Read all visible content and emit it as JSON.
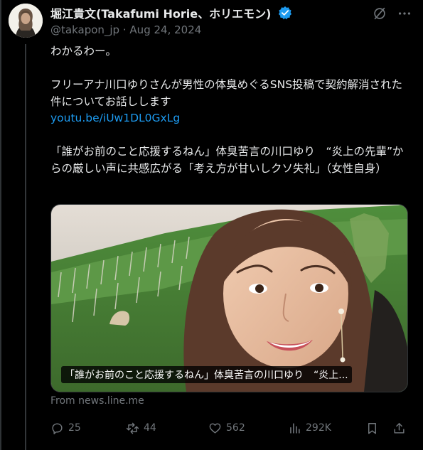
{
  "author": {
    "name": "堀江貴文(Takafumi Horie、ホリエモン)",
    "handle": "@takapon_jp",
    "date": "Aug 24, 2024"
  },
  "tweet": {
    "line1": "わかるわー。",
    "line2": "フリーアナ川口ゆりさんが男性の体臭めぐるSNS投稿で契約解消された件についてお話しします",
    "link": "youtu.be/iUw1DL0GxLg",
    "line3": "「誰がお前のこと応援するねん」体臭苦言の川口ゆり　“炎上の先輩”からの厳しい声に共感広がる「考え方が甘いしクソ失礼」（女性自身）"
  },
  "card": {
    "caption": "「誰がお前のこと応援するねん」体臭苦言の川口ゆり　“炎上...",
    "source": "From news.line.me"
  },
  "actions": {
    "replies": "25",
    "reposts": "44",
    "likes": "562",
    "views": "292K"
  },
  "colors": {
    "background": "#000000",
    "text": "#e7e9ea",
    "muted": "#71767b",
    "link": "#1d9bf0",
    "verified": "#1d9bf0"
  },
  "icons": [
    "verified-badge-icon",
    "grok-icon",
    "more-icon",
    "reply-icon",
    "repost-icon",
    "like-icon",
    "views-icon",
    "bookmark-icon",
    "share-icon"
  ]
}
